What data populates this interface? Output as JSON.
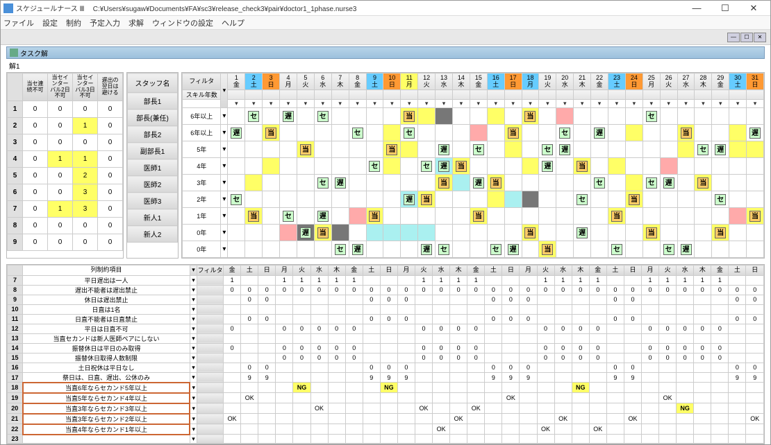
{
  "titlebar": {
    "app": "スケジュールナース Ⅲ",
    "path": "C:¥Users¥sugaw¥Documents¥FA¥sc3¥release_check3¥pair¥doctor1_1phase.nurse3"
  },
  "win_controls": {
    "min": "—",
    "max": "☐",
    "close": "✕"
  },
  "menubar": [
    "ファイル",
    "設定",
    "制約",
    "予定入力",
    "求解",
    "ウィンドウの設定",
    "ヘルプ"
  ],
  "task_pane": {
    "title": "タスク解",
    "sub": "解1"
  },
  "left_headers": [
    "当セ連続不可",
    "当セインターバル2日不可",
    "当セインターバル3日不可",
    "遅出の翌日は避ける"
  ],
  "staff_header": "スタッフ名",
  "filter_label": "フィルタ",
  "skill_label": "スキル年数",
  "rows": [
    {
      "n": "1",
      "vals": [
        "0",
        "0",
        "0",
        "0"
      ],
      "hl": [
        0,
        0,
        0,
        0
      ],
      "staff": "部長1",
      "skill": "6年以上"
    },
    {
      "n": "2",
      "vals": [
        "0",
        "0",
        "1",
        "0"
      ],
      "hl": [
        0,
        0,
        1,
        0
      ],
      "staff": "部長(兼任)",
      "skill": "6年以上"
    },
    {
      "n": "3",
      "vals": [
        "0",
        "0",
        "0",
        "0"
      ],
      "hl": [
        0,
        0,
        0,
        0
      ],
      "staff": "部長2",
      "skill": "5年"
    },
    {
      "n": "4",
      "vals": [
        "0",
        "1",
        "1",
        "0"
      ],
      "hl": [
        0,
        1,
        1,
        0
      ],
      "staff": "副部長1",
      "skill": "4年"
    },
    {
      "n": "5",
      "vals": [
        "0",
        "0",
        "2",
        "0"
      ],
      "hl": [
        0,
        0,
        1,
        0
      ],
      "staff": "医師1",
      "skill": "3年"
    },
    {
      "n": "6",
      "vals": [
        "0",
        "0",
        "3",
        "0"
      ],
      "hl": [
        0,
        0,
        1,
        0
      ],
      "staff": "医師2",
      "skill": "2年"
    },
    {
      "n": "7",
      "vals": [
        "0",
        "1",
        "3",
        "0"
      ],
      "hl": [
        0,
        1,
        1,
        0
      ],
      "staff": "医師3",
      "skill": "1年"
    },
    {
      "n": "8",
      "vals": [
        "0",
        "0",
        "0",
        "0"
      ],
      "hl": [
        0,
        0,
        0,
        0
      ],
      "staff": "新人1",
      "skill": "0年"
    },
    {
      "n": "9",
      "vals": [
        "0",
        "0",
        "0",
        "0"
      ],
      "hl": [
        0,
        0,
        0,
        0
      ],
      "staff": "新人2",
      "skill": "0年"
    }
  ],
  "days": [
    {
      "d": "1",
      "w": "金",
      "c": ""
    },
    {
      "d": "2",
      "w": "土",
      "c": "sat"
    },
    {
      "d": "3",
      "w": "日",
      "c": "sun"
    },
    {
      "d": "4",
      "w": "月",
      "c": ""
    },
    {
      "d": "5",
      "w": "火",
      "c": ""
    },
    {
      "d": "6",
      "w": "水",
      "c": ""
    },
    {
      "d": "7",
      "w": "木",
      "c": ""
    },
    {
      "d": "8",
      "w": "金",
      "c": ""
    },
    {
      "d": "9",
      "w": "土",
      "c": "sat"
    },
    {
      "d": "10",
      "w": "日",
      "c": "sun"
    },
    {
      "d": "11",
      "w": "月",
      "c": "hol"
    },
    {
      "d": "12",
      "w": "火",
      "c": ""
    },
    {
      "d": "13",
      "w": "水",
      "c": ""
    },
    {
      "d": "14",
      "w": "木",
      "c": ""
    },
    {
      "d": "15",
      "w": "金",
      "c": ""
    },
    {
      "d": "16",
      "w": "土",
      "c": "sat"
    },
    {
      "d": "17",
      "w": "日",
      "c": "sun"
    },
    {
      "d": "18",
      "w": "月",
      "c": "sat"
    },
    {
      "d": "19",
      "w": "火",
      "c": ""
    },
    {
      "d": "20",
      "w": "水",
      "c": ""
    },
    {
      "d": "21",
      "w": "木",
      "c": ""
    },
    {
      "d": "22",
      "w": "金",
      "c": ""
    },
    {
      "d": "23",
      "w": "土",
      "c": "sat"
    },
    {
      "d": "24",
      "w": "日",
      "c": "sun"
    },
    {
      "d": "25",
      "w": "月",
      "c": ""
    },
    {
      "d": "26",
      "w": "火",
      "c": ""
    },
    {
      "d": "27",
      "w": "水",
      "c": ""
    },
    {
      "d": "28",
      "w": "木",
      "c": ""
    },
    {
      "d": "29",
      "w": "金",
      "c": ""
    },
    {
      "d": "30",
      "w": "土",
      "c": "sat"
    },
    {
      "d": "31",
      "w": "日",
      "c": "sun"
    }
  ],
  "shift_labels": {
    "se": "セ",
    "chi": "遅",
    "tou": "当"
  },
  "schedule": [
    [
      null,
      [
        "セ",
        ""
      ],
      null,
      [
        "遅",
        ""
      ],
      null,
      [
        "セ",
        ""
      ],
      null,
      null,
      null,
      null,
      [
        "当",
        "cell-yellow"
      ],
      [
        "",
        "cell-yellow"
      ],
      [
        "",
        "cell-gray"
      ],
      null,
      null,
      [
        "",
        "cell-yellow"
      ],
      null,
      [
        "当",
        "cell-yellow"
      ],
      null,
      [
        "",
        "cell-pink"
      ],
      null,
      null,
      null,
      null,
      [
        "セ",
        ""
      ],
      null,
      null,
      null,
      null,
      null,
      null
    ],
    [
      [
        "遅",
        ""
      ],
      null,
      [
        "当",
        "cell-yellow"
      ],
      null,
      null,
      null,
      null,
      [
        "セ",
        ""
      ],
      null,
      [
        "",
        "cell-yellow"
      ],
      [
        "セ",
        ""
      ],
      null,
      null,
      null,
      [
        "",
        "cell-pink"
      ],
      null,
      [
        "当",
        "cell-yellow"
      ],
      null,
      null,
      [
        "セ",
        ""
      ],
      null,
      [
        "遅",
        ""
      ],
      null,
      [
        "",
        "cell-yellow"
      ],
      null,
      null,
      [
        "当",
        "cell-yellow"
      ],
      null,
      null,
      [
        "",
        "cell-yellow"
      ],
      [
        "遅",
        ""
      ]
    ],
    [
      null,
      null,
      null,
      null,
      [
        "当",
        "cell-yellow"
      ],
      null,
      null,
      null,
      null,
      [
        "当",
        "cell-yellow"
      ],
      [
        "",
        "cell-yellow"
      ],
      null,
      [
        "遅",
        ""
      ],
      null,
      [
        "セ",
        ""
      ],
      null,
      [
        "",
        "cell-yellow"
      ],
      null,
      [
        "セ",
        ""
      ],
      [
        "遅",
        ""
      ],
      null,
      null,
      null,
      null,
      null,
      null,
      [
        "",
        "cell-yellow"
      ],
      [
        "セ",
        ""
      ],
      [
        "遅",
        ""
      ],
      [
        "",
        "cell-yellow"
      ],
      [
        "",
        "cell-yellow"
      ]
    ],
    [
      null,
      null,
      [
        "",
        "cell-yellow"
      ],
      null,
      null,
      null,
      null,
      null,
      [
        "セ",
        ""
      ],
      [
        "",
        "cell-yellow"
      ],
      null,
      [
        "セ",
        ""
      ],
      [
        "遅",
        "cell-cyan"
      ],
      [
        "当",
        "cell-yellow"
      ],
      null,
      null,
      null,
      [
        "",
        "cell-yellow"
      ],
      [
        "遅",
        ""
      ],
      null,
      [
        "当",
        "cell-yellow"
      ],
      null,
      [
        "",
        "cell-yellow"
      ],
      null,
      null,
      [
        "",
        "cell-pink"
      ],
      null,
      null,
      null,
      null,
      null
    ],
    [
      null,
      [
        "",
        "cell-yellow"
      ],
      null,
      null,
      null,
      [
        "セ",
        ""
      ],
      [
        "遅",
        ""
      ],
      null,
      null,
      null,
      null,
      null,
      [
        "当",
        "cell-yellow"
      ],
      [
        "",
        "cell-cyan"
      ],
      [
        "遅",
        ""
      ],
      [
        "当",
        "cell-yellow"
      ],
      null,
      null,
      null,
      null,
      null,
      [
        "セ",
        ""
      ],
      null,
      [
        "",
        "cell-yellow"
      ],
      [
        "セ",
        ""
      ],
      [
        "遅",
        ""
      ],
      null,
      [
        "当",
        "cell-yellow"
      ],
      null,
      null,
      null
    ],
    [
      [
        "セ",
        ""
      ],
      null,
      null,
      null,
      null,
      null,
      null,
      null,
      null,
      null,
      [
        "遅",
        "cell-cyan"
      ],
      [
        "当",
        "cell-yellow"
      ],
      null,
      null,
      null,
      [
        "",
        "cell-yellow"
      ],
      [
        "",
        "cell-cyan"
      ],
      [
        "",
        "cell-gray"
      ],
      null,
      null,
      [
        "セ",
        ""
      ],
      null,
      null,
      [
        "当",
        "cell-yellow"
      ],
      null,
      null,
      null,
      null,
      [
        "セ",
        ""
      ],
      null,
      null
    ],
    [
      null,
      [
        "当",
        "cell-yellow"
      ],
      null,
      [
        "セ",
        ""
      ],
      null,
      [
        "遅",
        ""
      ],
      null,
      [
        "",
        "cell-pink"
      ],
      [
        "当",
        "cell-yellow"
      ],
      null,
      null,
      null,
      null,
      null,
      [
        "当",
        "cell-yellow"
      ],
      null,
      null,
      null,
      null,
      null,
      null,
      null,
      [
        "当",
        "cell-yellow"
      ],
      null,
      null,
      null,
      null,
      null,
      null,
      [
        "",
        "cell-pink"
      ],
      [
        "当",
        "cell-yellow"
      ]
    ],
    [
      null,
      null,
      null,
      [
        "",
        "cell-pink"
      ],
      [
        "遅",
        "cell-gray"
      ],
      [
        "当",
        "cell-yellow"
      ],
      [
        "",
        "cell-gray"
      ],
      null,
      [
        "",
        "cell-cyan"
      ],
      [
        "",
        "cell-cyan"
      ],
      [
        "",
        "cell-cyan"
      ],
      [
        "",
        "cell-cyan"
      ],
      null,
      null,
      null,
      null,
      null,
      [
        "当",
        "cell-yellow"
      ],
      null,
      null,
      [
        "遅",
        ""
      ],
      null,
      null,
      null,
      [
        "当",
        "cell-yellow"
      ],
      null,
      null,
      null,
      [
        "当",
        "cell-yellow"
      ],
      null,
      null
    ],
    [
      null,
      null,
      null,
      null,
      null,
      null,
      [
        "セ",
        ""
      ],
      [
        "遅",
        ""
      ],
      null,
      null,
      null,
      [
        "遅",
        ""
      ],
      [
        "セ",
        ""
      ],
      null,
      null,
      [
        "セ",
        ""
      ],
      [
        "遅",
        ""
      ],
      null,
      [
        "当",
        "cell-yellow"
      ],
      null,
      null,
      null,
      [
        "セ",
        ""
      ],
      null,
      null,
      [
        "セ",
        ""
      ],
      [
        "遅",
        ""
      ],
      null,
      null,
      null,
      null
    ]
  ],
  "bottom_header_cols": [
    "列制約項目"
  ],
  "bottom_filter": "フィルタ",
  "bottom_days": [
    "金",
    "土",
    "日",
    "月",
    "火",
    "水",
    "木",
    "金",
    "土",
    "日",
    "月",
    "火",
    "水",
    "木",
    "金",
    "土",
    "日",
    "月",
    "火",
    "水",
    "木",
    "金",
    "土",
    "日",
    "月",
    "火",
    "水",
    "木",
    "金",
    "土",
    "日"
  ],
  "constraints": [
    {
      "n": "7",
      "name": "平日遅出は一人",
      "v": [
        "1",
        "",
        "",
        "1",
        "1",
        "1",
        "1",
        "1",
        "",
        "",
        "",
        "1",
        "1",
        "1",
        "1",
        "",
        "",
        "",
        "1",
        "1",
        "1",
        "1",
        "",
        "",
        "1",
        "1",
        "1",
        "1",
        "1",
        "",
        ""
      ]
    },
    {
      "n": "8",
      "name": "遅出不能者は遅出禁止",
      "v": [
        "0",
        "0",
        "0",
        "0",
        "0",
        "0",
        "0",
        "0",
        "0",
        "0",
        "0",
        "0",
        "0",
        "0",
        "0",
        "0",
        "0",
        "0",
        "0",
        "0",
        "0",
        "0",
        "0",
        "0",
        "0",
        "0",
        "0",
        "0",
        "0",
        "0",
        "0"
      ]
    },
    {
      "n": "9",
      "name": "休日は遅出禁止",
      "v": [
        "",
        "0",
        "0",
        "",
        "",
        "",
        "",
        "",
        "0",
        "0",
        "0",
        "",
        "",
        "",
        "",
        "0",
        "0",
        "0",
        "",
        "",
        "",
        "",
        "0",
        "0",
        "",
        "",
        "",
        "",
        "",
        "0",
        "0"
      ]
    },
    {
      "n": "10",
      "name": "日直は1名",
      "v": [
        "",
        "",
        "",
        "",
        "",
        "",
        "",
        "",
        "",
        "",
        "",
        "",
        "",
        "",
        "",
        "",
        "",
        "",
        "",
        "",
        "",
        "",
        "",
        "",
        "",
        "",
        "",
        "",
        "",
        "",
        ""
      ]
    },
    {
      "n": "11",
      "name": "日直不能者は日直禁止",
      "v": [
        "",
        "0",
        "0",
        "",
        "",
        "",
        "",
        "",
        "0",
        "0",
        "0",
        "",
        "",
        "",
        "",
        "0",
        "0",
        "0",
        "",
        "",
        "",
        "",
        "0",
        "0",
        "",
        "",
        "",
        "",
        "",
        "0",
        "0"
      ]
    },
    {
      "n": "12",
      "name": "平日は日直不可",
      "v": [
        "0",
        "",
        "",
        "0",
        "0",
        "0",
        "0",
        "0",
        "",
        "",
        "",
        "0",
        "0",
        "0",
        "0",
        "",
        "",
        "",
        "0",
        "0",
        "0",
        "0",
        "",
        "",
        "0",
        "0",
        "0",
        "0",
        "0",
        "",
        ""
      ]
    },
    {
      "n": "13",
      "name": "当直セカンドは新人医師ペアにしない",
      "v": [
        "",
        "",
        "",
        "",
        "",
        "",
        "",
        "",
        "",
        "",
        "",
        "",
        "",
        "",
        "",
        "",
        "",
        "",
        "",
        "",
        "",
        "",
        "",
        "",
        "",
        "",
        "",
        "",
        "",
        "",
        ""
      ]
    },
    {
      "n": "14",
      "name": "振替休日は平日のみ取得",
      "v": [
        "0",
        "",
        "",
        "0",
        "0",
        "0",
        "0",
        "0",
        "",
        "",
        "",
        "0",
        "0",
        "0",
        "0",
        "",
        "",
        "",
        "0",
        "0",
        "0",
        "0",
        "",
        "",
        "0",
        "0",
        "0",
        "0",
        "0",
        "",
        ""
      ]
    },
    {
      "n": "15",
      "name": "振替休日取得人数制限",
      "v": [
        "",
        "",
        "",
        "0",
        "0",
        "0",
        "0",
        "0",
        "",
        "",
        "",
        "0",
        "0",
        "0",
        "0",
        "",
        "",
        "",
        "0",
        "0",
        "0",
        "0",
        "",
        "",
        "0",
        "0",
        "0",
        "0",
        "0",
        "",
        ""
      ]
    },
    {
      "n": "16",
      "name": "土日祝休は平日なし",
      "v": [
        "",
        "0",
        "0",
        "",
        "",
        "",
        "",
        "",
        "0",
        "0",
        "0",
        "",
        "",
        "",
        "",
        "0",
        "0",
        "0",
        "",
        "",
        "",
        "",
        "0",
        "0",
        "",
        "",
        "",
        "",
        "",
        "0",
        "0"
      ]
    },
    {
      "n": "17",
      "name": "祭日は、日直、遅出、公休のみ",
      "v": [
        "",
        "9",
        "9",
        "",
        "",
        "",
        "",
        "",
        "9",
        "9",
        "9",
        "",
        "",
        "",
        "",
        "9",
        "9",
        "9",
        "",
        "",
        "",
        "",
        "9",
        "9",
        "",
        "",
        "",
        "",
        "",
        "9",
        "9"
      ]
    },
    {
      "n": "18",
      "name": "当直6年ならセカンド5年以上",
      "v": [
        "",
        "",
        "",
        "",
        "NG",
        "",
        "",
        "",
        "",
        "NG",
        "",
        "",
        "",
        "",
        "",
        "",
        "",
        "",
        "",
        "",
        "NG",
        "",
        "",
        "",
        "",
        "",
        "",
        "",
        "",
        "",
        ""
      ],
      "hl": true
    },
    {
      "n": "19",
      "name": "当直5年ならセカンド4年以上",
      "v": [
        "",
        "OK",
        "",
        "",
        "",
        "",
        "",
        "",
        "",
        "",
        "",
        "",
        "",
        "",
        "",
        "",
        "OK",
        "",
        "",
        "",
        "",
        "",
        "",
        "",
        "",
        "OK",
        "",
        "",
        "",
        "",
        ""
      ],
      "hl": true
    },
    {
      "n": "20",
      "name": "当直3年ならセカンド3年以上",
      "v": [
        "",
        "",
        "",
        "",
        "",
        "OK",
        "",
        "",
        "",
        "",
        "",
        "OK",
        "",
        "",
        "OK",
        "",
        "",
        "",
        "",
        "",
        "",
        "",
        "",
        "",
        "",
        "",
        "NG",
        "",
        "",
        "",
        ""
      ],
      "hl": true
    },
    {
      "n": "21",
      "name": "当直3年ならセカンド2年以上",
      "v": [
        "OK",
        "",
        "",
        "",
        "",
        "",
        "",
        "",
        "",
        "",
        "",
        "",
        "",
        "OK",
        "",
        "",
        "",
        "",
        "",
        "OK",
        "",
        "",
        "",
        "OK",
        "",
        "",
        "",
        "",
        "",
        "",
        "OK"
      ],
      "hl": true
    },
    {
      "n": "22",
      "name": "当直4年ならセカンド1年以上",
      "v": [
        "",
        "",
        "",
        "",
        "",
        "",
        "",
        "",
        "",
        "",
        "",
        "",
        "OK",
        "",
        "",
        "",
        "",
        "",
        "OK",
        "",
        "",
        "OK",
        "",
        "",
        "",
        "",
        "",
        "",
        "",
        "",
        ""
      ],
      "hl": true
    },
    {
      "n": "23",
      "name": "",
      "v": [
        "",
        "",
        "",
        "",
        "",
        "",
        "",
        "",
        "",
        "",
        "",
        "",
        "",
        "",
        "",
        "",
        "",
        "",
        "",
        "",
        "",
        "",
        "",
        "",
        "",
        "",
        "",
        "",
        "",
        "",
        ""
      ]
    }
  ]
}
